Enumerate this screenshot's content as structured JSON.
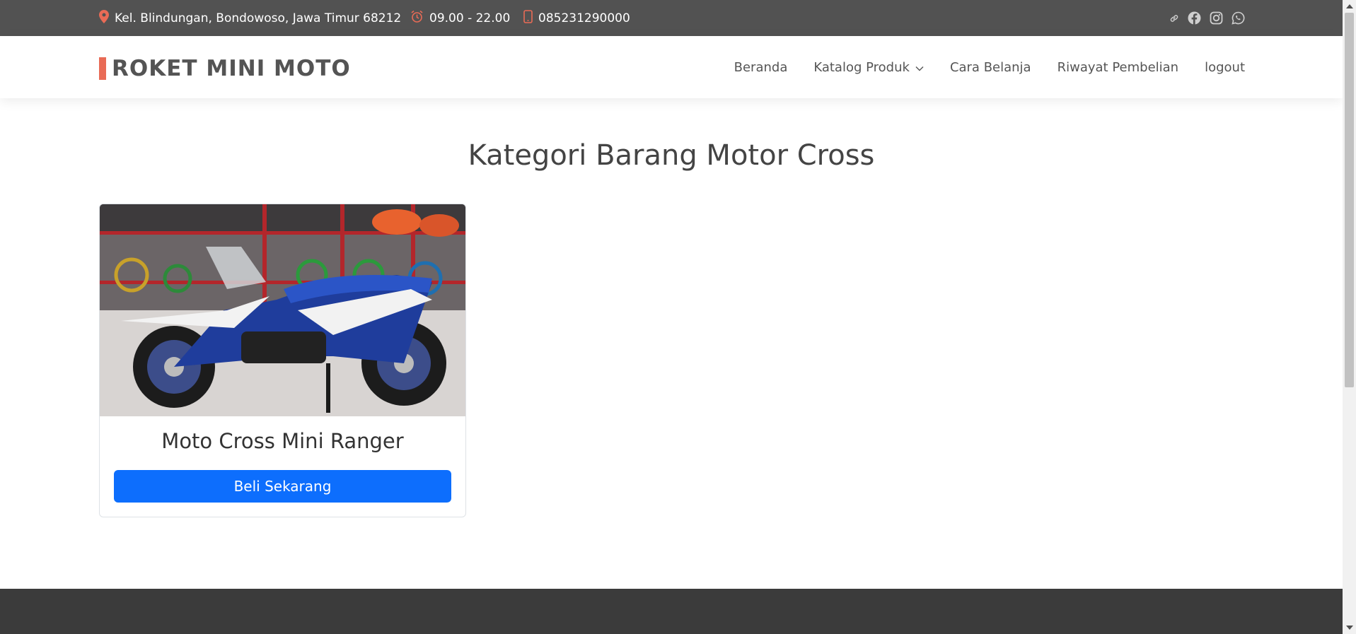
{
  "topbar": {
    "address": "Kel. Blindungan, Bondowoso, Jawa Timur 68212",
    "hours": "09.00 - 22.00",
    "phone": "085231290000",
    "icon_color": "#e96b56",
    "icons": [
      "map-pin-icon",
      "alarm-clock-icon",
      "phone-icon"
    ],
    "socials": [
      "link-icon",
      "facebook-icon",
      "instagram-icon",
      "whatsapp-icon"
    ]
  },
  "header": {
    "brand": "ROKET MINI MOTO",
    "brand_accent": "#e96b56",
    "nav": {
      "home": "Beranda",
      "catalog": "Katalog Produk",
      "how_to_buy": "Cara Belanja",
      "history": "Riwayat Pembelian",
      "logout": "logout"
    }
  },
  "main": {
    "title": "Kategori Barang Motor Cross",
    "products": [
      {
        "name": "Moto Cross Mini Ranger",
        "button_label": "Beli Sekarang",
        "image": "blue-mini-dirt-bike-photo"
      }
    ]
  },
  "colors": {
    "topbar_bg": "#525252",
    "button_bg": "#0d6efd",
    "footer_bg": "#3b3b3b"
  }
}
